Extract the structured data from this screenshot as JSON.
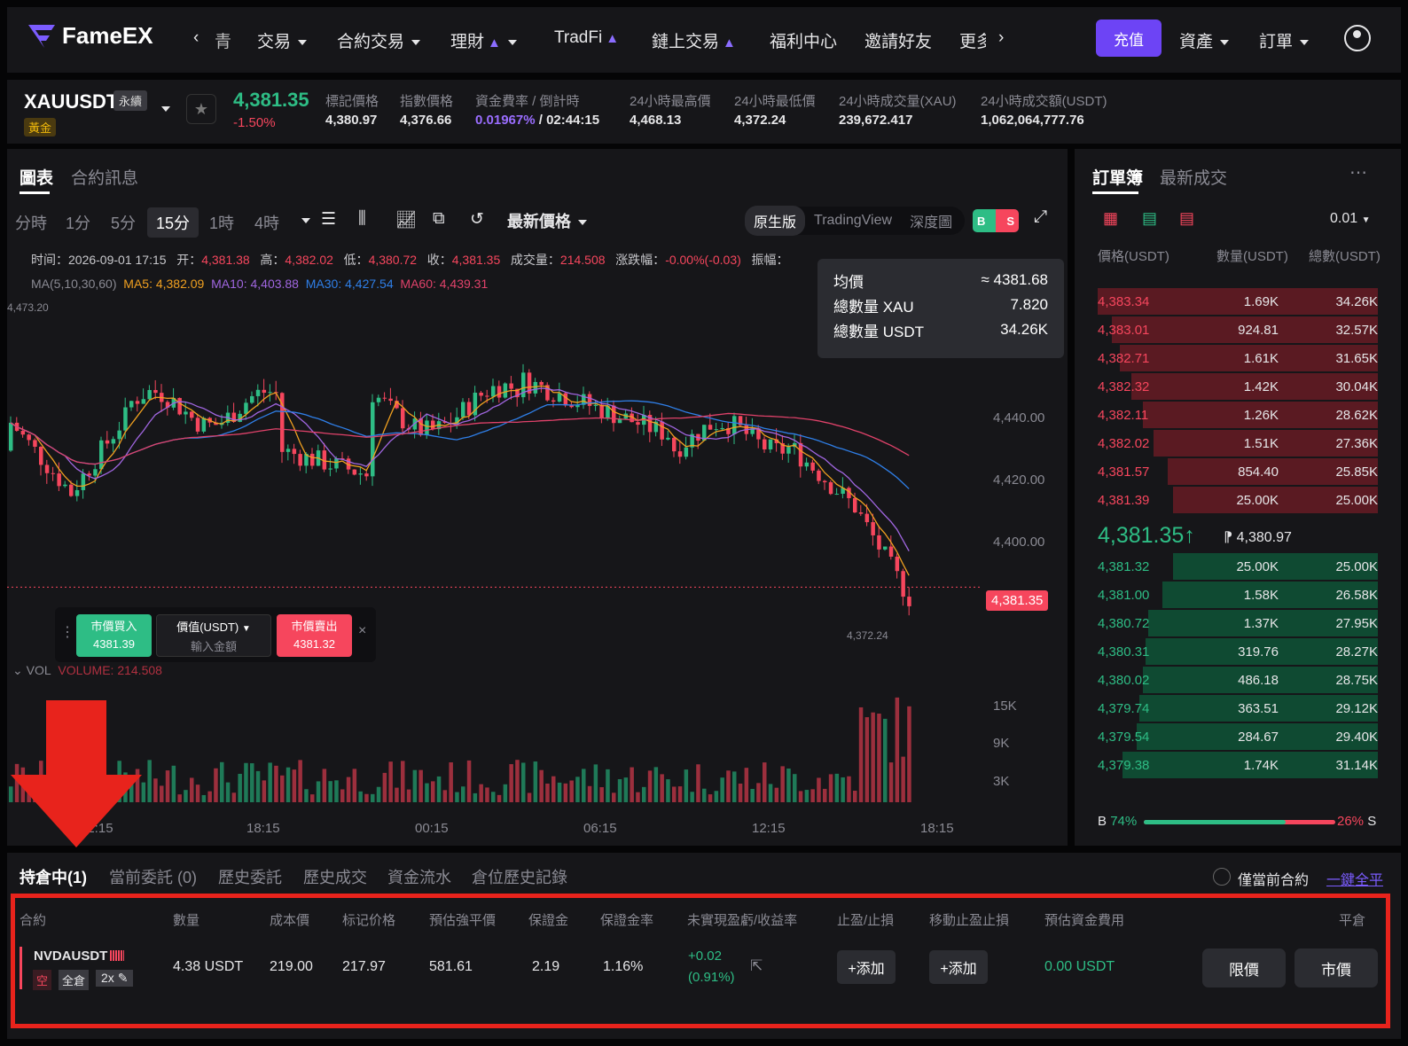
{
  "nav": {
    "brand": "FameEX",
    "left_arrow": "‹",
    "partial_left": "青",
    "items": [
      "交易",
      "合約交易",
      "理財",
      "TradFi",
      "鏈上交易",
      "福利中心",
      "邀請好友",
      "更多"
    ],
    "right_arrow": "›",
    "deposit": "充值",
    "assets": "資產",
    "orders": "訂單"
  },
  "ticker": {
    "symbol": "XAUUSDT",
    "perp": "永續",
    "tag": "黃金",
    "last": "4,381.35",
    "change": "-1.50%",
    "stats": [
      {
        "label": "標記價格",
        "value": "4,380.97"
      },
      {
        "label": "指數價格",
        "value": "4,376.66"
      },
      {
        "label": "資金費率 / 倒計時",
        "value": "0.01967%",
        "value2": " / 02:44:15"
      },
      {
        "label": "24小時最高價",
        "value": "4,468.13"
      },
      {
        "label": "24小時最低價",
        "value": "4,372.24"
      },
      {
        "label": "24小時成交量(XAU)",
        "value": "239,672.417"
      },
      {
        "label": "24小時成交額(USDT)",
        "value": "1,062,064,777.76"
      }
    ]
  },
  "chart": {
    "tabs": [
      "圖表",
      "合約訊息"
    ],
    "timeframes": [
      "分時",
      "1分",
      "5分",
      "15分",
      "1時",
      "4時"
    ],
    "price_type": "最新價格",
    "versions": [
      "原生版",
      "TradingView",
      "深度圖"
    ],
    "bs": [
      "B",
      "S"
    ],
    "ohlc": {
      "time_label": "时间：",
      "time": "2026-09-01 17:15",
      "open_label": "开：",
      "open": "4,381.38",
      "high_label": "高：",
      "high": "4,382.02",
      "low_label": "低：",
      "low": "4,380.72",
      "close_label": "收：",
      "close": "4,381.35",
      "vol_label": "成交量：",
      "vol": "214.508",
      "chg_label": "涨跌幅：",
      "chg": "-0.00%(-0.03)",
      "amp_label": "振幅："
    },
    "ma": {
      "label": "MA(5,10,30,60)",
      "ma5": "MA5: 4,382.09",
      "ma10": "MA10: 4,403.88",
      "ma30": "MA30: 4,427.54",
      "ma60": "MA60: 4,439.31"
    },
    "high_marker": "4,473.20",
    "low_marker": "4,372.24",
    "current_price": "4,381.35",
    "tooltip": {
      "avg_label": "均價",
      "avg": "≈ 4381.68",
      "qty_label": "總數量 XAU",
      "qty": "7.820",
      "usdt_label": "總數量 USDT",
      "usdt": "34.26K"
    },
    "quick": {
      "buy_label": "市價買入",
      "buy_price": "4381.39",
      "value_label": "價值(USDT)",
      "value_placeholder": "輸入金額",
      "sell_label": "市價賣出",
      "sell_price": "4381.32"
    },
    "vol": {
      "label": "VOL",
      "volume": "VOLUME: 214.508"
    },
    "y_axis": [
      "4,440.00",
      "4,420.00",
      "4,400.00"
    ],
    "vol_axis": [
      "15K",
      "9K",
      "3K"
    ],
    "x_axis": [
      "12:15",
      "18:15",
      "00:15",
      "06:15",
      "12:15",
      "18:15"
    ]
  },
  "chart_data": {
    "type": "candlestick",
    "title": "",
    "last": 4381.35,
    "high": 4473.2,
    "low": 4372.24,
    "ma": {
      "MA5": 4382.09,
      "MA10": 4403.88,
      "MA30": 4427.54,
      "MA60": 4439.31
    },
    "ylim": [
      4360,
      4480
    ],
    "colors": {
      "up": "#2ebd85",
      "down": "#f6465d",
      "ma5": "#f0a020",
      "ma10": "#a066e0",
      "ma30": "#2f7fe8",
      "ma60": "#e0426a"
    }
  },
  "orderbook": {
    "tabs": [
      "訂單簿",
      "最新成交"
    ],
    "precision": "0.01",
    "cols": [
      "價格(USDT)",
      "數量(USDT)",
      "總數(USDT)"
    ],
    "asks": [
      {
        "p": "4,383.34",
        "q": "1.69K",
        "t": "34.26K",
        "d": 1
      },
      {
        "p": "4,383.01",
        "q": "924.81",
        "t": "32.57K",
        "d": 0.95
      },
      {
        "p": "4,382.71",
        "q": "1.61K",
        "t": "31.65K",
        "d": 0.92
      },
      {
        "p": "4,382.32",
        "q": "1.42K",
        "t": "30.04K",
        "d": 0.88
      },
      {
        "p": "4,382.11",
        "q": "1.26K",
        "t": "28.62K",
        "d": 0.84
      },
      {
        "p": "4,382.02",
        "q": "1.51K",
        "t": "27.36K",
        "d": 0.8
      },
      {
        "p": "4,381.57",
        "q": "854.40",
        "t": "25.85K",
        "d": 0.75
      },
      {
        "p": "4,381.39",
        "q": "25.00K",
        "t": "25.00K",
        "d": 0.73
      }
    ],
    "last": "4,381.35",
    "last_arrow": "↑",
    "mark_flag": "⁋",
    "mark": "4,380.97",
    "bids": [
      {
        "p": "4,381.32",
        "q": "25.00K",
        "t": "25.00K",
        "d": 0.73
      },
      {
        "p": "4,381.00",
        "q": "1.58K",
        "t": "26.58K",
        "d": 0.77
      },
      {
        "p": "4,380.72",
        "q": "1.37K",
        "t": "27.95K",
        "d": 0.82
      },
      {
        "p": "4,380.31",
        "q": "319.76",
        "t": "28.27K",
        "d": 0.83
      },
      {
        "p": "4,380.02",
        "q": "486.18",
        "t": "28.75K",
        "d": 0.84
      },
      {
        "p": "4,379.74",
        "q": "363.51",
        "t": "29.12K",
        "d": 0.85
      },
      {
        "p": "4,379.54",
        "q": "284.67",
        "t": "29.40K",
        "d": 0.86
      },
      {
        "p": "4,379.38",
        "q": "1.74K",
        "t": "31.14K",
        "d": 0.91
      }
    ],
    "ratio_b_label": "B",
    "ratio_b": "74%",
    "ratio_s": "26%",
    "ratio_s_label": "S",
    "ratio_b_value": 0.74
  },
  "positions": {
    "tabs": [
      "持倉中(1)",
      "當前委託 (0)",
      "歷史委託",
      "歷史成交",
      "資金流水",
      "倉位歷史記錄"
    ],
    "current_only": "僅當前合約",
    "close_all": "一鍵全平",
    "headers": [
      "合約",
      "數量",
      "成本價",
      "标记价格",
      "預估強平價",
      "保證金",
      "保證金率",
      "未實現盈虧/收益率",
      "止盈/止損",
      "移動止盈止損",
      "預估資金費用",
      "平倉"
    ],
    "row": {
      "symbol": "NVDAUSDT",
      "side": "空",
      "margin_mode": "全倉",
      "leverage": "2x",
      "qty": "4.38 USDT",
      "entry": "219.00",
      "mark": "217.97",
      "liq": "581.61",
      "margin": "2.19",
      "margin_rate": "1.16%",
      "pnl": "+0.02",
      "roe": "(0.91%)",
      "tpsl": "+添加",
      "trailing": "+添加",
      "funding": "0.00 USDT",
      "limit": "限價",
      "market": "市價"
    }
  },
  "annotation": {
    "arrow_color": "#e8231c"
  }
}
